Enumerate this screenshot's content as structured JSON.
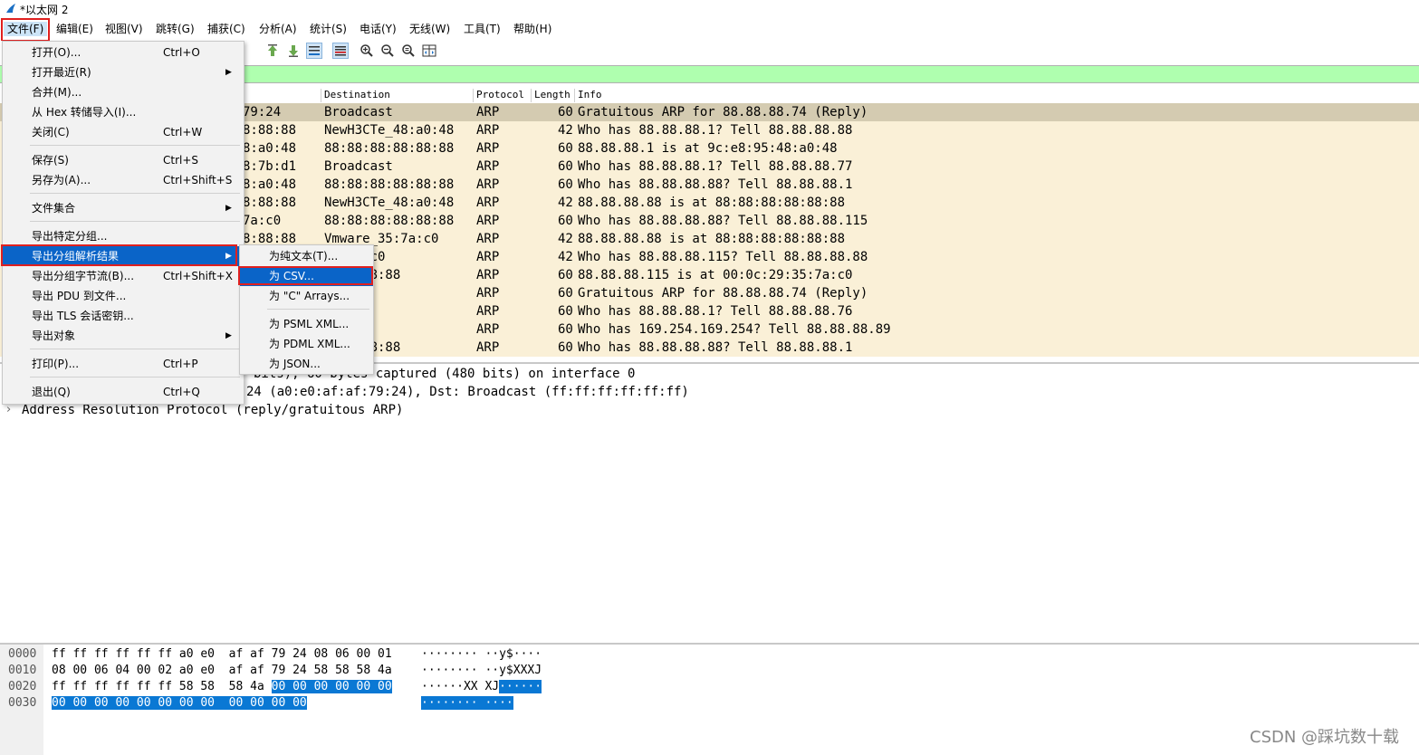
{
  "window": {
    "title": "*以太网 2"
  },
  "menubar": [
    "文件(F)",
    "编辑(E)",
    "视图(V)",
    "跳转(G)",
    "捕获(C)",
    "分析(A)",
    "统计(S)",
    "电话(Y)",
    "无线(W)",
    "工具(T)",
    "帮助(H)"
  ],
  "columns": {
    "destination": "Destination",
    "protocol": "Protocol",
    "length": "Length",
    "info": "Info"
  },
  "packets": [
    {
      "src": "79:24",
      "dst": "Broadcast",
      "proto": "ARP",
      "len": "60",
      "info": "Gratuitous ARP for 88.88.88.74 (Reply)"
    },
    {
      "src": "8:88:88",
      "dst": "NewH3CTe_48:a0:48",
      "proto": "ARP",
      "len": "42",
      "info": "Who has 88.88.88.1? Tell 88.88.88.88"
    },
    {
      "src": "8:a0:48",
      "dst": "88:88:88:88:88:88",
      "proto": "ARP",
      "len": "60",
      "info": "88.88.88.1 is at 9c:e8:95:48:a0:48"
    },
    {
      "src": "8:7b:d1",
      "dst": "Broadcast",
      "proto": "ARP",
      "len": "60",
      "info": "Who has 88.88.88.1? Tell 88.88.88.77"
    },
    {
      "src": "8:a0:48",
      "dst": "88:88:88:88:88:88",
      "proto": "ARP",
      "len": "60",
      "info": "Who has 88.88.88.88? Tell 88.88.88.1"
    },
    {
      "src": "8:88:88",
      "dst": "NewH3CTe_48:a0:48",
      "proto": "ARP",
      "len": "42",
      "info": "88.88.88.88 is at 88:88:88:88:88:88"
    },
    {
      "src": "7a:c0",
      "dst": "88:88:88:88:88:88",
      "proto": "ARP",
      "len": "60",
      "info": "Who has 88.88.88.88? Tell 88.88.88.115"
    },
    {
      "src": "8:88:88",
      "dst": "Vmware_35:7a:c0",
      "proto": "ARP",
      "len": "42",
      "info": "88.88.88.88 is at 88:88:88:88:88:88"
    },
    {
      "src": "",
      "dst": "35:7a:c0",
      "proto": "ARP",
      "len": "42",
      "info": "Who has 88.88.88.115? Tell 88.88.88.88"
    },
    {
      "src": "",
      "dst": "8:88:88:88",
      "proto": "ARP",
      "len": "60",
      "info": "88.88.88.115 is at 00:0c:29:35:7a:c0"
    },
    {
      "src": "",
      "dst": "st",
      "proto": "ARP",
      "len": "60",
      "info": "Gratuitous ARP for 88.88.88.74 (Reply)"
    },
    {
      "src": "",
      "dst": "st",
      "proto": "ARP",
      "len": "60",
      "info": "Who has 88.88.88.1? Tell 88.88.88.76"
    },
    {
      "src": "",
      "dst": "st",
      "proto": "ARP",
      "len": "60",
      "info": "Who has 169.254.169.254? Tell 88.88.88.89"
    },
    {
      "src": "",
      "dst": "8:88:88:88",
      "proto": "ARP",
      "len": "60",
      "info": "Who has 88.88.88.88? Tell 88.88.88.1"
    }
  ],
  "details": [
    "bits), 60 bytes captured (480 bits) on interface 0",
    "24 (a0:e0:af:af:79:24), Dst: Broadcast (ff:ff:ff:ff:ff:ff)",
    "Address Resolution Protocol (reply/gratuitous ARP)"
  ],
  "bytes": [
    {
      "off": "0000",
      "hex": "ff ff ff ff ff ff a0 e0  af af 79 24 08 06 00 01",
      "hexsel": "",
      "ascii": "········ ··y$····",
      "asciisel": ""
    },
    {
      "off": "0010",
      "hex": "08 00 06 04 00 02 a0 e0  af af 79 24 58 58 58 4a",
      "hexsel": "",
      "ascii": "········ ··y$XXXJ",
      "asciisel": ""
    },
    {
      "off": "0020",
      "hex": "ff ff ff ff ff ff 58 58  58 4a ",
      "hexsel": "00 00 00 00 00 00",
      "ascii": "······XX XJ",
      "asciisel": "······"
    },
    {
      "off": "0030",
      "hex": "",
      "hexsel": "00 00 00 00 00 00 00 00  00 00 00 00",
      "ascii": "",
      "asciisel": "········ ····"
    }
  ],
  "file_menu": [
    {
      "label": "打开(O)...",
      "shortcut": "Ctrl+O",
      "arrow": ""
    },
    {
      "label": "打开最近(R)",
      "shortcut": "",
      "arrow": "▶"
    },
    {
      "label": "合并(M)...",
      "shortcut": "",
      "arrow": ""
    },
    {
      "label": "从 Hex 转储导入(I)...",
      "shortcut": "",
      "arrow": ""
    },
    {
      "label": "关闭(C)",
      "shortcut": "Ctrl+W",
      "arrow": ""
    },
    {
      "label": "保存(S)",
      "shortcut": "Ctrl+S",
      "arrow": ""
    },
    {
      "label": "另存为(A)...",
      "shortcut": "Ctrl+Shift+S",
      "arrow": ""
    },
    {
      "label": "文件集合",
      "shortcut": "",
      "arrow": "▶"
    },
    {
      "label": "导出特定分组...",
      "shortcut": "",
      "arrow": ""
    },
    {
      "label": "导出分组解析结果",
      "shortcut": "",
      "arrow": "▶"
    },
    {
      "label": "导出分组字节流(B)...",
      "shortcut": "Ctrl+Shift+X",
      "arrow": ""
    },
    {
      "label": "导出 PDU 到文件...",
      "shortcut": "",
      "arrow": ""
    },
    {
      "label": "导出 TLS 会话密钥...",
      "shortcut": "",
      "arrow": ""
    },
    {
      "label": "导出对象",
      "shortcut": "",
      "arrow": "▶"
    },
    {
      "label": "打印(P)...",
      "shortcut": "Ctrl+P",
      "arrow": ""
    },
    {
      "label": "退出(Q)",
      "shortcut": "Ctrl+Q",
      "arrow": ""
    }
  ],
  "export_submenu": [
    "为纯文本(T)...",
    "为 CSV...",
    "为 \"C\" Arrays...",
    "为 PSML XML...",
    "为 PDML XML...",
    "为 JSON..."
  ],
  "watermark": "CSDN @踩坑数十载",
  "colors": {
    "row_bg": "#faf0d7",
    "row_selected": "#d4cbb1",
    "filter_bg": "#afffaf",
    "menu_highlight": "#0a64c8",
    "annotation_red": "#e0201f"
  }
}
